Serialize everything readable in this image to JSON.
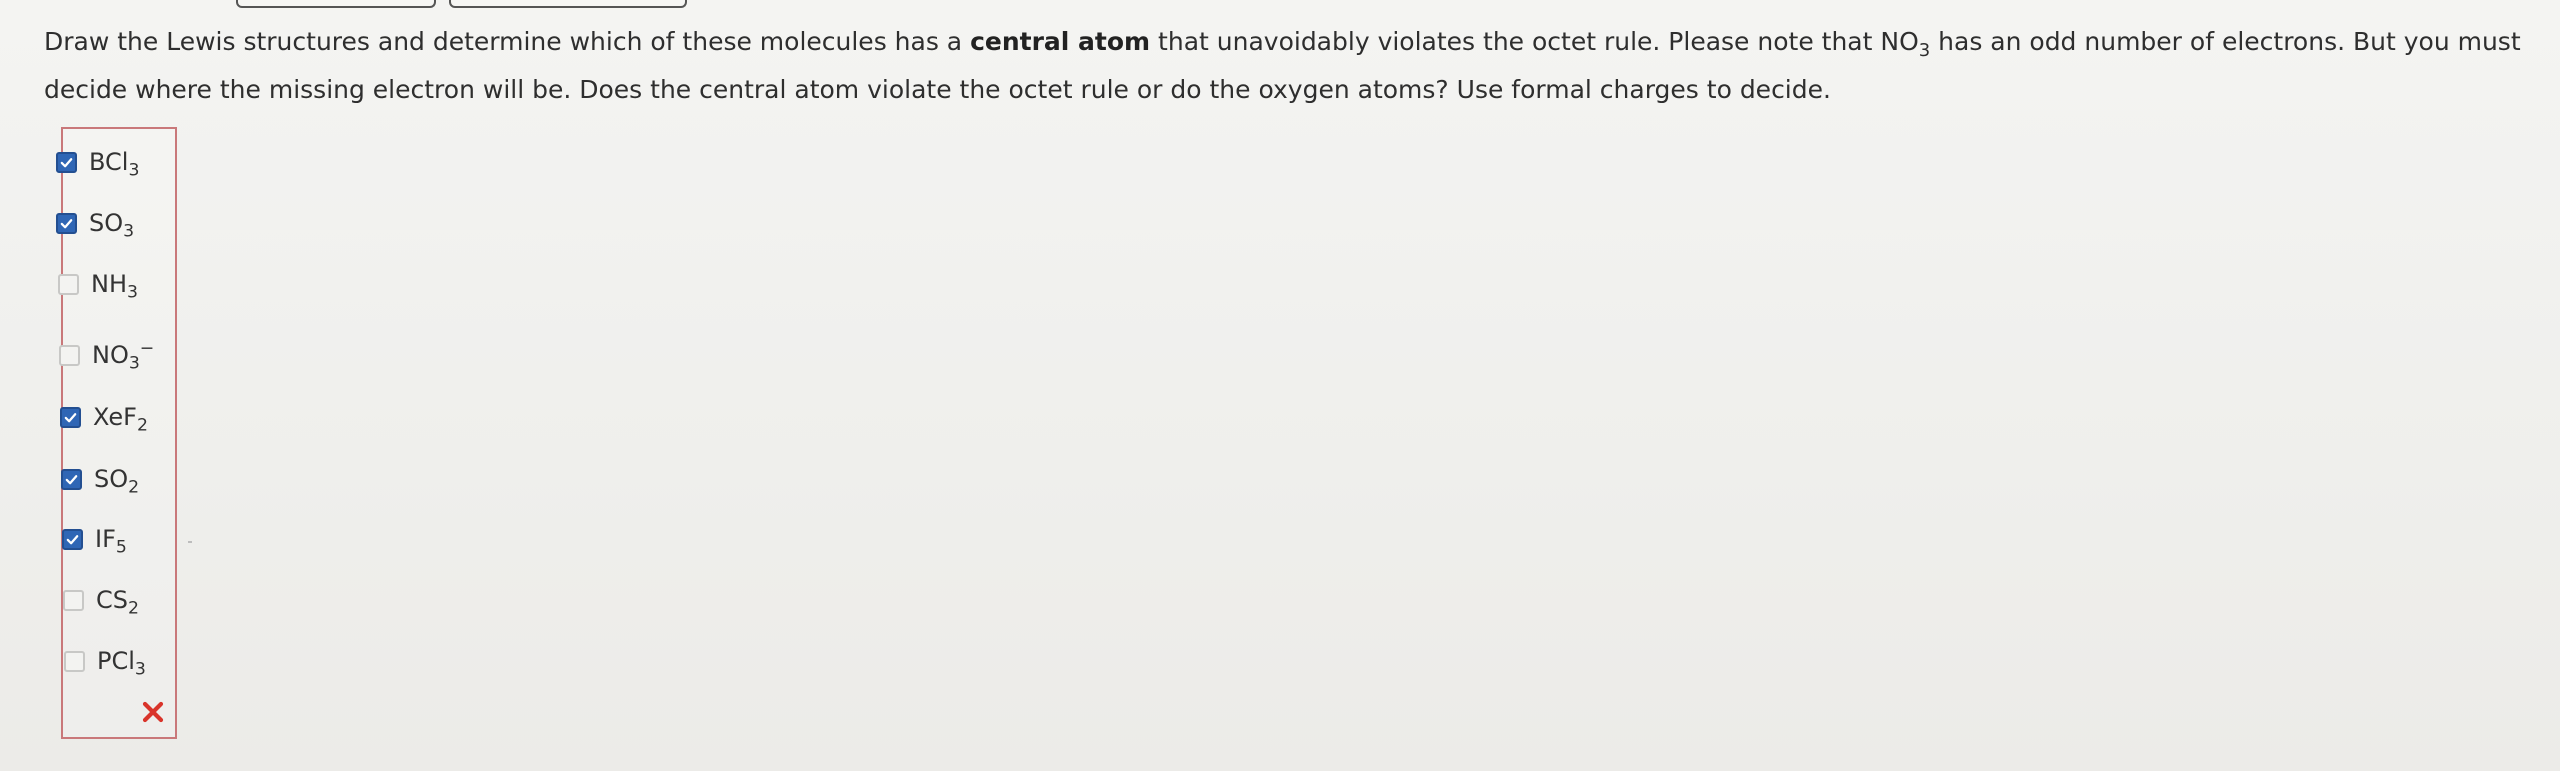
{
  "question": {
    "part1": "Draw the Lewis structures and determine which of these molecules has a ",
    "bold": "central atom",
    "part2": " that unavoidably violates the octet rule. Please note that NO",
    "sub": "3",
    "part3": " has an odd number of electrons. But you must decide where the missing electron will be. Does the central atom violate the octet rule or do the oxygen atoms? Use formal charges to decide."
  },
  "options": [
    {
      "base": "BCl",
      "sub": "3",
      "sup": "",
      "checked": true
    },
    {
      "base": "SO",
      "sub": "3",
      "sup": "",
      "checked": true
    },
    {
      "base": "NH",
      "sub": "3",
      "sup": "",
      "checked": false
    },
    {
      "base": "NO",
      "sub": "3",
      "sup": "−",
      "checked": false
    },
    {
      "base": "XeF",
      "sub": "2",
      "sup": "",
      "checked": true
    },
    {
      "base": "SO",
      "sub": "2",
      "sup": "",
      "checked": true
    },
    {
      "base": "IF",
      "sub": "5",
      "sup": "",
      "checked": true
    },
    {
      "base": "CS",
      "sub": "2",
      "sup": "",
      "checked": false
    },
    {
      "base": "PCl",
      "sub": "3",
      "sup": "",
      "checked": false
    }
  ],
  "result": {
    "icon": "x-icon",
    "color": "#d9342b"
  },
  "colors": {
    "check_blue": "#2f66b5",
    "box_border": "#c9787a"
  }
}
